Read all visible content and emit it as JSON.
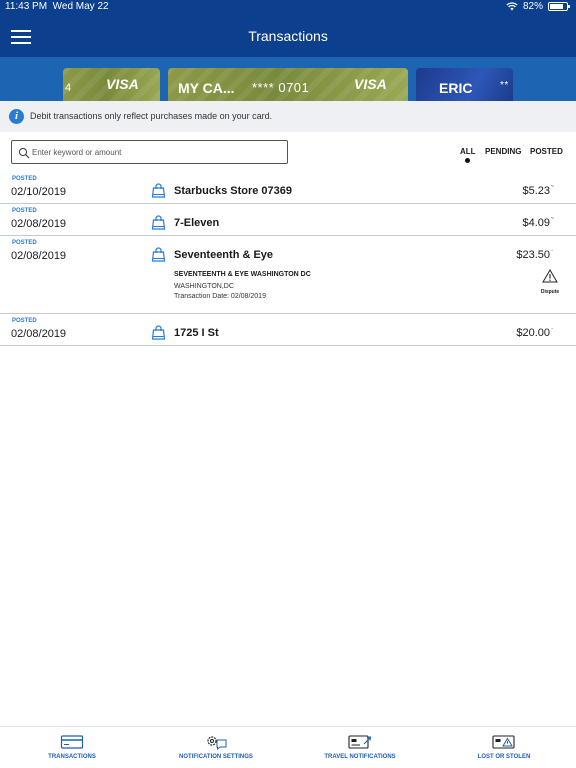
{
  "status_bar": {
    "time": "11:43 PM",
    "date": "Wed May 22",
    "battery": "82%"
  },
  "header": {
    "title": "Transactions",
    "menu_icon": "hamburger-menu-icon"
  },
  "cards": [
    {
      "visa": "VISA",
      "digit": "4"
    },
    {
      "name": "MY CA...",
      "number": "**** 0701",
      "visa": "VISA"
    },
    {
      "name": "ERIC",
      "number": "**"
    }
  ],
  "info_banner": {
    "icon": "info-icon",
    "text": "Debit transactions only reflect purchases made on your card."
  },
  "search": {
    "placeholder": "Enter keyword or amount",
    "value": ""
  },
  "filters": {
    "all": "ALL",
    "pending": "PENDING",
    "posted": "POSTED",
    "selected": "ALL"
  },
  "transactions": [
    {
      "status": "POSTED",
      "date": "02/10/2019",
      "merchant": "Starbucks Store 07369",
      "amount": "$5.23"
    },
    {
      "status": "POSTED",
      "date": "02/08/2019",
      "merchant": "7-Eleven",
      "amount": "$4.09"
    },
    {
      "status": "POSTED",
      "date": "02/08/2019",
      "merchant": "Seventeenth & Eye",
      "amount": "$23.50",
      "detail_name": "SEVENTEENTH & EYE WASHINGTON DC",
      "detail_location": "WASHINGTON,DC",
      "detail_date": "Transaction Date: 02/08/2019",
      "dispute_label": "Dispute"
    },
    {
      "status": "POSTED",
      "date": "02/08/2019",
      "merchant": "1725 I St",
      "amount": "$20.00"
    }
  ],
  "tab_bar": [
    {
      "label": "TRANSACTIONS",
      "icon": "credit-card-icon"
    },
    {
      "label": "NOTIFICATION SETTINGS",
      "icon": "gears-chat-icon"
    },
    {
      "label": "TRAVEL NOTIFICATIONS",
      "icon": "card-airplane-icon"
    },
    {
      "label": "LOST OR STOLEN",
      "icon": "card-warning-icon"
    }
  ],
  "colors": {
    "nav_blue": "#0c3f8e",
    "carousel_blue": "#1d64b2",
    "accent": "#2a7bd4",
    "tab_label": "#1d5fb5"
  }
}
